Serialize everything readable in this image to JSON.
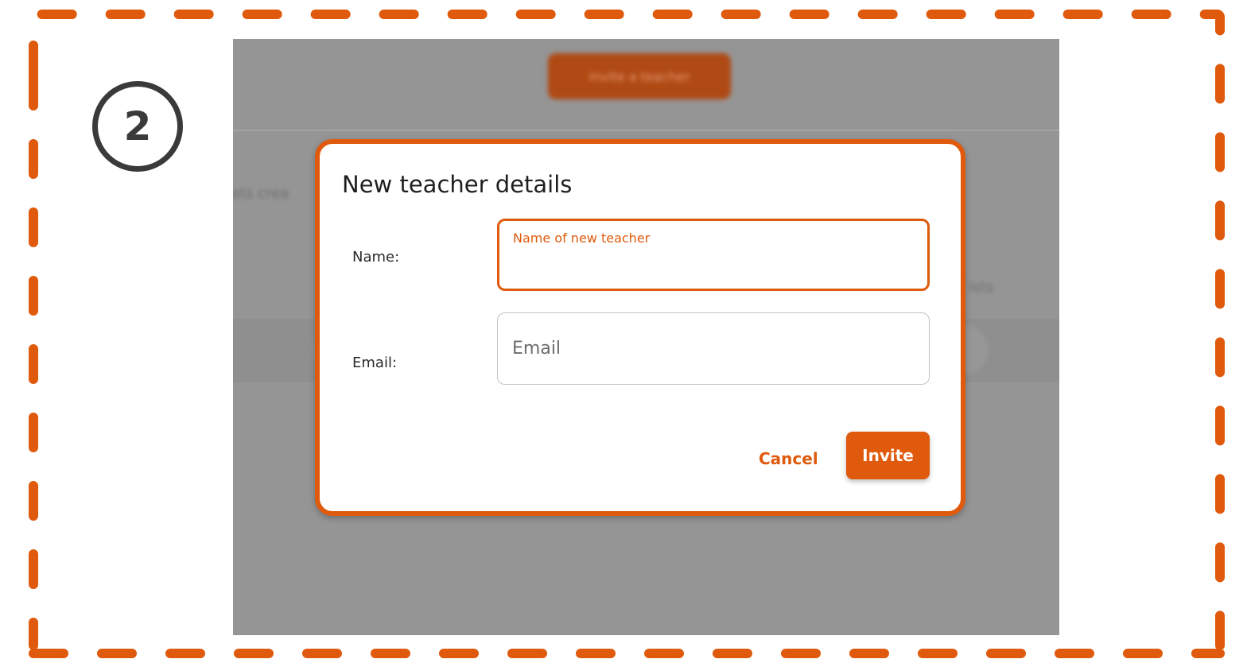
{
  "step": {
    "number": "2"
  },
  "background": {
    "invite_button_label": "Invite a teacher",
    "blurred_text_left": "ets crea",
    "blurred_text_right": "ists"
  },
  "dialog": {
    "title": "New teacher details",
    "name_label": "Name:",
    "name_field": {
      "floating_label": "Name of new teacher",
      "value": ""
    },
    "email_label": "Email:",
    "email_field": {
      "placeholder": "Email",
      "value": ""
    },
    "cancel_label": "Cancel",
    "invite_label": "Invite"
  },
  "colors": {
    "accent": "#df5a0c",
    "overlay": "#959595",
    "badge": "#3a3a3a"
  }
}
